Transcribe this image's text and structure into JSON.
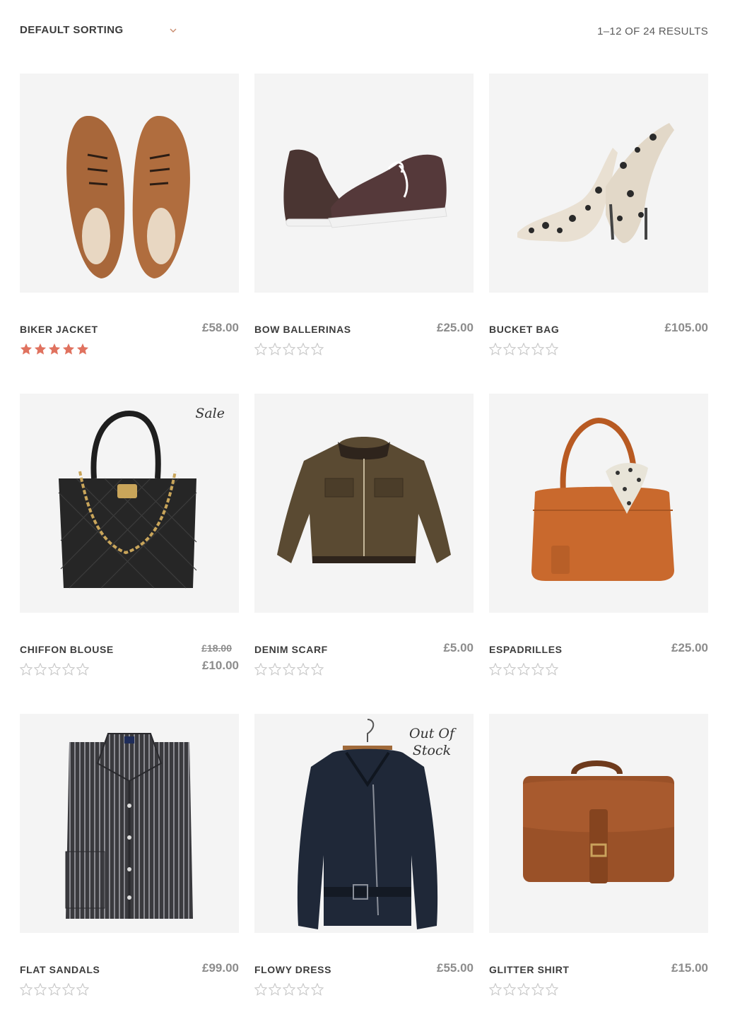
{
  "toolbar": {
    "sort_label": "DEFAULT SORTING",
    "result_count": "1–12 OF 24 RESULTS"
  },
  "colors": {
    "star_filled": "#e0725f",
    "star_empty": "#c9c9c9",
    "thumb_bg": "#f4f4f4"
  },
  "products": [
    {
      "name": "BIKER JACKET",
      "price": "£58.00",
      "rating": 5,
      "image": "brown-brogues-icon"
    },
    {
      "name": "BOW BALLERINAS",
      "price": "£25.00",
      "rating": 0,
      "image": "dark-sneakers-icon"
    },
    {
      "name": "BUCKET BAG",
      "price": "£105.00",
      "rating": 0,
      "image": "leopard-heels-icon"
    },
    {
      "name": "CHIFFON BLOUSE",
      "price_old": "£18.00",
      "price": "£10.00",
      "badge": "Sale",
      "rating": 0,
      "image": "quilted-handbag-icon"
    },
    {
      "name": "DENIM SCARF",
      "price": "£5.00",
      "rating": 0,
      "image": "bomber-jacket-icon"
    },
    {
      "name": "ESPADRILLES",
      "price": "£25.00",
      "rating": 0,
      "image": "tan-bag-scarf-icon"
    },
    {
      "name": "FLAT SANDALS",
      "price": "£99.00",
      "rating": 0,
      "image": "striped-shirt-icon"
    },
    {
      "name": "FLOWY DRESS",
      "price": "£55.00",
      "badge": "Out Of Stock",
      "rating": 0,
      "image": "leather-jacket-icon"
    },
    {
      "name": "GLITTER SHIRT",
      "price": "£15.00",
      "rating": 0,
      "image": "leather-satchel-icon"
    }
  ]
}
